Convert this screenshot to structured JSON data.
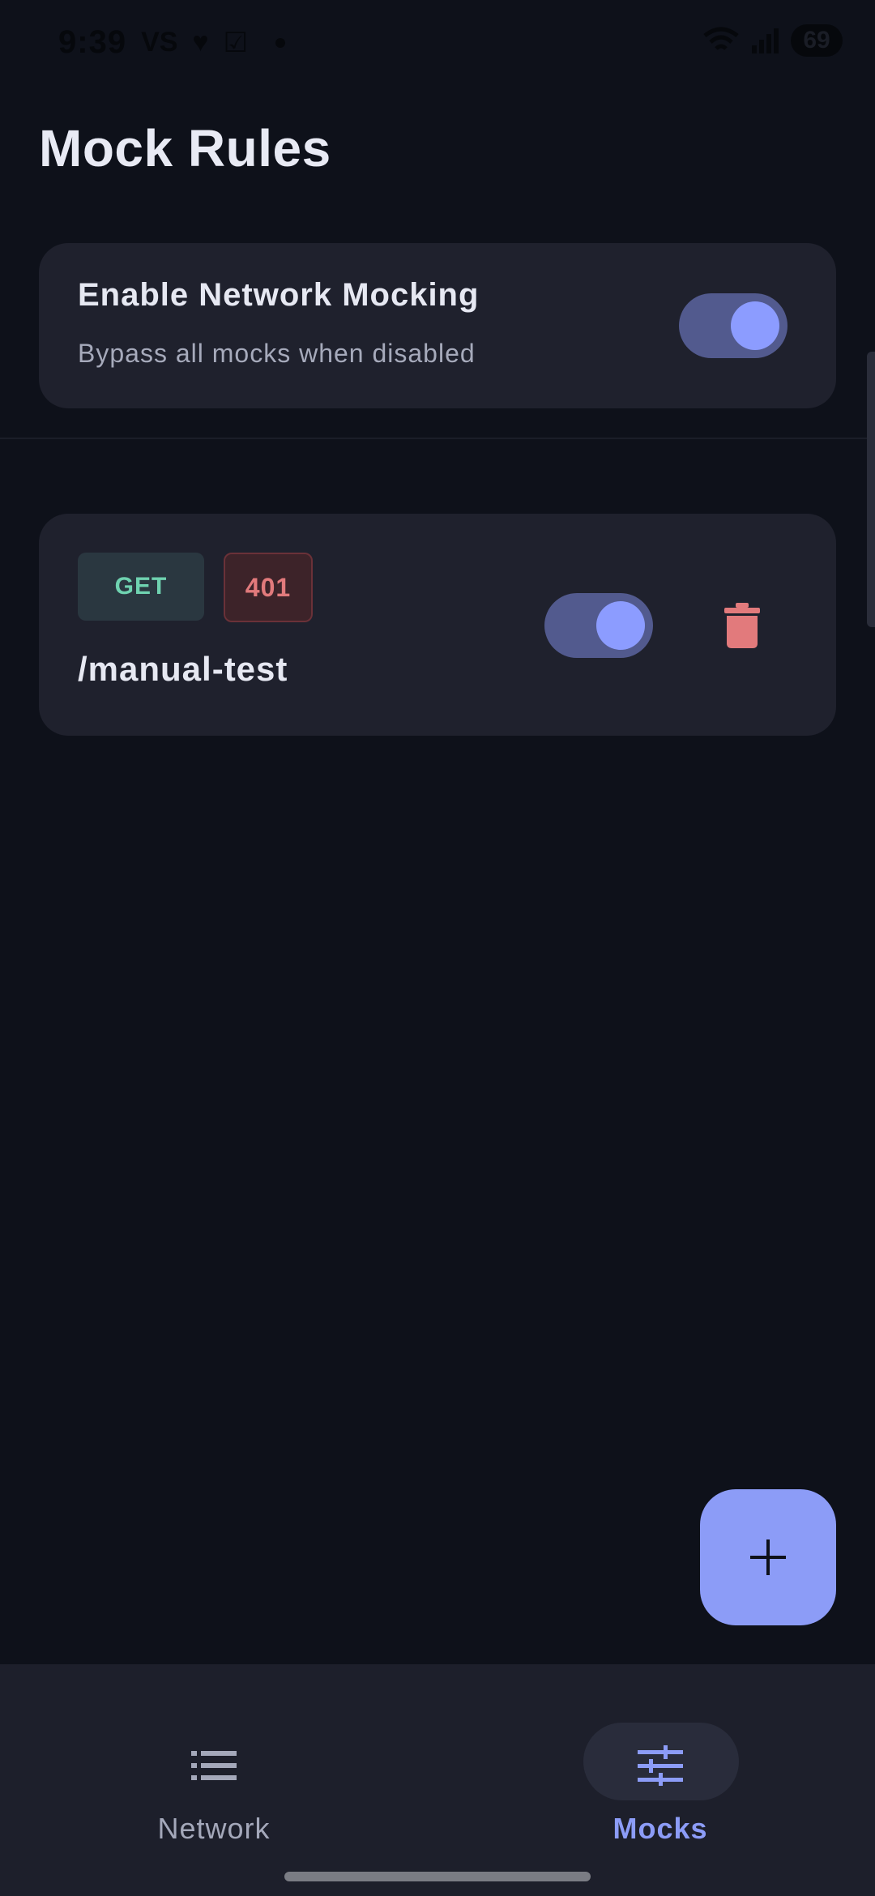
{
  "status_bar": {
    "time": "9:39",
    "carrier_glyph": "VS",
    "battery": "69"
  },
  "page": {
    "title": "Mock Rules"
  },
  "global_toggle": {
    "title": "Enable Network Mocking",
    "subtitle": "Bypass all mocks when disabled",
    "enabled": true
  },
  "rules": [
    {
      "method": "GET",
      "status_code": "401",
      "path": "/manual-test",
      "enabled": true
    }
  ],
  "icons": {
    "delete": "trash-icon",
    "add": "plus-icon",
    "network": "list-icon",
    "mocks": "sliders-icon"
  },
  "bottom_nav": {
    "items": [
      {
        "label": "Network",
        "selected": false
      },
      {
        "label": "Mocks",
        "selected": true
      }
    ]
  },
  "colors": {
    "background": "#0e111a",
    "card": "#1f212d",
    "accent": "#8c9cf7",
    "method_get": "#6fd2b0",
    "status_error": "#e27a7c"
  }
}
